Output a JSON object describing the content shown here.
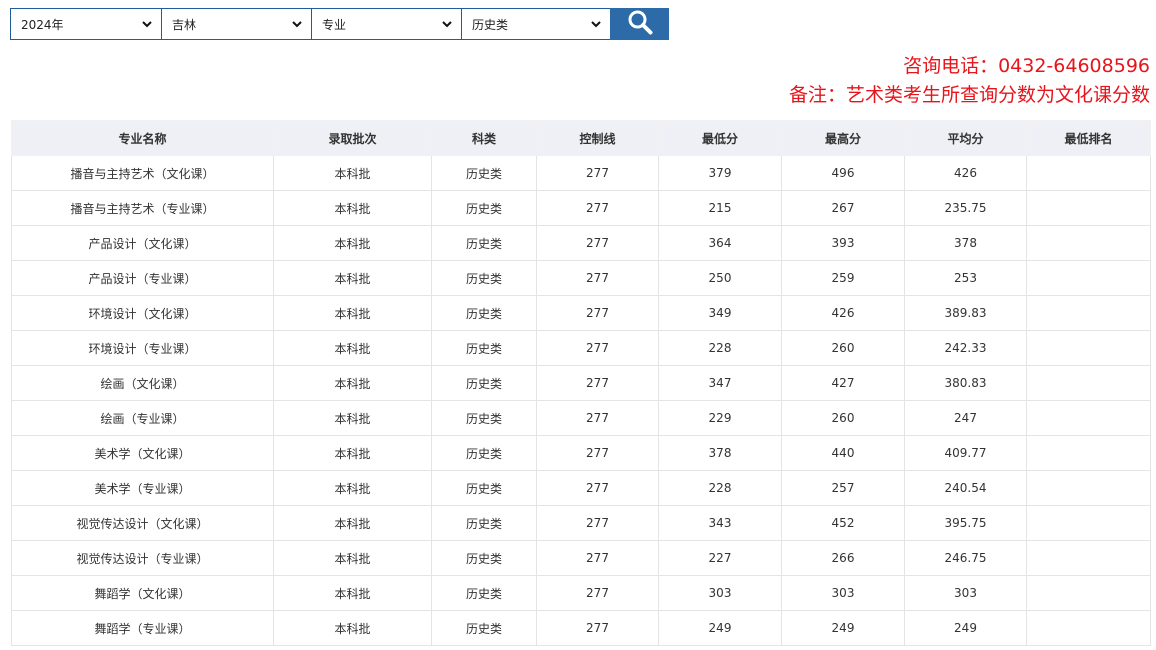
{
  "filters": [
    {
      "value": "2024年",
      "icon": "chevron-down-icon"
    },
    {
      "value": "吉林",
      "icon": "chevron-down-icon"
    },
    {
      "value": "专业",
      "icon": "chevron-down-icon"
    },
    {
      "value": "历史类",
      "icon": "chevron-down-icon"
    }
  ],
  "search_button": {
    "icon": "search-icon",
    "color": "#2d6aa8"
  },
  "contact": {
    "phone": "咨询电话：0432-64608596",
    "note": "备注：艺术类考生所查询分数为文化课分数",
    "color": "#e8141b"
  },
  "table": {
    "headers": [
      "专业名称",
      "录取批次",
      "科类",
      "控制线",
      "最低分",
      "最高分",
      "平均分",
      "最低排名"
    ],
    "rows": [
      [
        "播音与主持艺术（文化课）",
        "本科批",
        "历史类",
        "277",
        "379",
        "496",
        "426",
        ""
      ],
      [
        "播音与主持艺术（专业课）",
        "本科批",
        "历史类",
        "277",
        "215",
        "267",
        "235.75",
        ""
      ],
      [
        "产品设计（文化课）",
        "本科批",
        "历史类",
        "277",
        "364",
        "393",
        "378",
        ""
      ],
      [
        "产品设计（专业课）",
        "本科批",
        "历史类",
        "277",
        "250",
        "259",
        "253",
        ""
      ],
      [
        "环境设计（文化课）",
        "本科批",
        "历史类",
        "277",
        "349",
        "426",
        "389.83",
        ""
      ],
      [
        "环境设计（专业课）",
        "本科批",
        "历史类",
        "277",
        "228",
        "260",
        "242.33",
        ""
      ],
      [
        "绘画（文化课）",
        "本科批",
        "历史类",
        "277",
        "347",
        "427",
        "380.83",
        ""
      ],
      [
        "绘画（专业课）",
        "本科批",
        "历史类",
        "277",
        "229",
        "260",
        "247",
        ""
      ],
      [
        "美术学（文化课）",
        "本科批",
        "历史类",
        "277",
        "378",
        "440",
        "409.77",
        ""
      ],
      [
        "美术学（专业课）",
        "本科批",
        "历史类",
        "277",
        "228",
        "257",
        "240.54",
        ""
      ],
      [
        "视觉传达设计（文化课）",
        "本科批",
        "历史类",
        "277",
        "343",
        "452",
        "395.75",
        ""
      ],
      [
        "视觉传达设计（专业课）",
        "本科批",
        "历史类",
        "277",
        "227",
        "266",
        "246.75",
        ""
      ],
      [
        "舞蹈学（文化课）",
        "本科批",
        "历史类",
        "277",
        "303",
        "303",
        "303",
        ""
      ],
      [
        "舞蹈学（专业课）",
        "本科批",
        "历史类",
        "277",
        "249",
        "249",
        "249",
        ""
      ]
    ]
  }
}
